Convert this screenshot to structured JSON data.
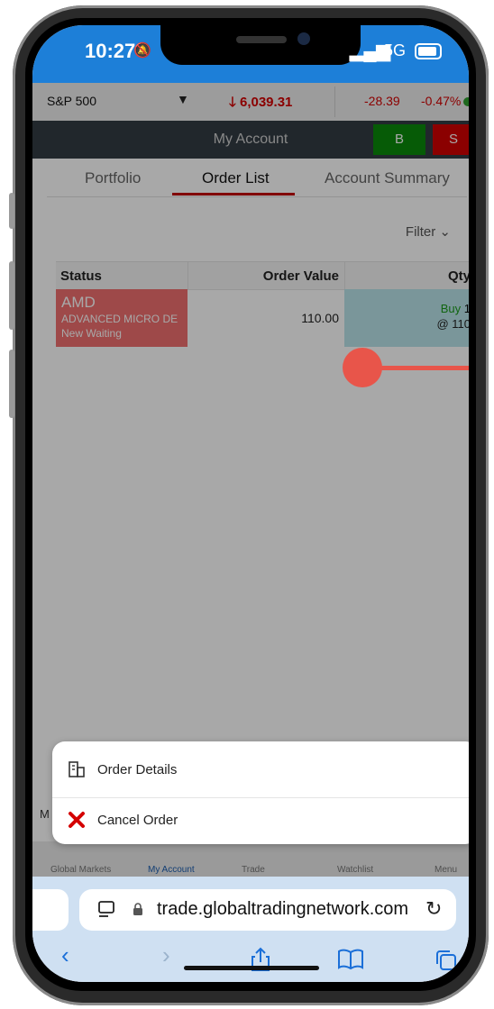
{
  "status_bar": {
    "time": "10:27",
    "network": "5G"
  },
  "ticker": {
    "name": "S&P 500",
    "value": "6,039.31",
    "change": "-28.39",
    "percent": "-0.47%"
  },
  "header": {
    "title": "My Account",
    "buy_label": "B",
    "sell_label": "S"
  },
  "tabs": [
    {
      "label": "Portfolio"
    },
    {
      "label": "Order List"
    },
    {
      "label": "Account Summary"
    }
  ],
  "filter_label": "Filter",
  "table": {
    "headers": [
      "Status",
      "Order Value",
      "Qty"
    ],
    "rows": [
      {
        "symbol": "AMD",
        "description": "ADVANCED MICRO DE",
        "status": "New Waiting",
        "order_value": "110.00",
        "side": "Buy",
        "qty": "1",
        "price": "@ 110"
      }
    ]
  },
  "action_sheet": {
    "items": [
      {
        "label": "Order Details"
      },
      {
        "label": "Cancel Order"
      }
    ]
  },
  "bottom_nav": [
    {
      "label": "Global Markets"
    },
    {
      "label": "My Account"
    },
    {
      "label": "Trade"
    },
    {
      "label": "Watchlist"
    },
    {
      "label": "Menu"
    }
  ],
  "bottom_left_letter": "M",
  "safari": {
    "url": "trade.globaltradingnetwork.com"
  },
  "colors": {
    "accent_red": "#d40000",
    "buy_green": "#0a8a0a",
    "status_bar_blue": "#1d7fd8",
    "touch_marker": "#e8554a"
  }
}
